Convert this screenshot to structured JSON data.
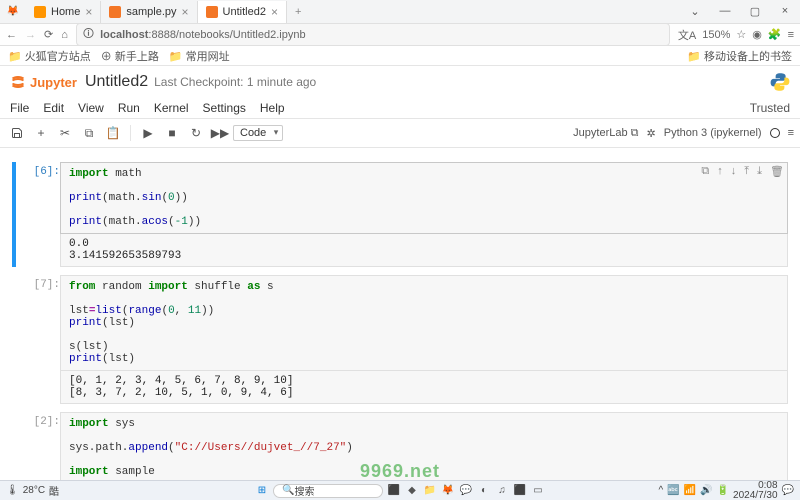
{
  "browser": {
    "tabs": [
      {
        "label": "Home",
        "active": false
      },
      {
        "label": "sample.py",
        "active": false
      },
      {
        "label": "Untitled2",
        "active": true
      }
    ],
    "url_host": "localhost",
    "url_rest": ":8888/notebooks/Untitled2.ipynb",
    "zoom": "150%",
    "bookmarks": [
      {
        "label": "火狐官方站点"
      },
      {
        "label": "新手上路"
      },
      {
        "label": "常用网址"
      }
    ],
    "bookmark_right": "移动设备上的书签"
  },
  "jupyter": {
    "brand": "Jupyter",
    "title": "Untitled2",
    "checkpoint": "Last Checkpoint: 1 minute ago",
    "menus": [
      "File",
      "Edit",
      "View",
      "Run",
      "Kernel",
      "Settings",
      "Help"
    ],
    "trusted": "Trusted",
    "cell_type": "Code",
    "right_label": "JupyterLab",
    "kernel": "Python 3 (ipykernel)"
  },
  "cells": [
    {
      "exec": "[6]:",
      "active": true,
      "output": "0.0\n3.141592653589793",
      "actions": true
    },
    {
      "exec": "[7]:",
      "active": false,
      "output": "[0, 1, 2, 3, 4, 5, 6, 7, 8, 9, 10]\n[8, 3, 7, 2, 10, 5, 1, 0, 9, 4, 6]"
    },
    {
      "exec": "[2]:",
      "active": false,
      "output": null
    }
  ],
  "cell0_lines": {
    "l1a": "import",
    "l1b": " math",
    "l3a": "print",
    "l3b": "(math.",
    "l3c": "sin",
    "l3d": "(",
    "l3e": "0",
    "l3f": "))",
    "l5a": "print",
    "l5b": "(math.",
    "l5c": "acos",
    "l5d": "(",
    "l5e": "-1",
    "l5f": "))"
  },
  "cell1_lines": {
    "l1": {
      "a": "from",
      "b": " random ",
      "c": "import",
      "d": " shuffle ",
      "e": "as",
      "f": " s"
    },
    "l3": {
      "a": "lst",
      "b": "=",
      "c": "list",
      "d": "(",
      "e": "range",
      "f": "(",
      "g": "0",
      "h": ", ",
      "i": "11",
      "j": "))"
    },
    "l4": {
      "a": "print",
      "b": "(lst)"
    },
    "l6": {
      "a": "s(lst)"
    },
    "l7": {
      "a": "print",
      "b": "(lst)"
    }
  },
  "cell2_lines": {
    "l1": {
      "a": "import",
      "b": " sys"
    },
    "l3": {
      "a": "sys.path.",
      "b": "append",
      "c": "(",
      "d": "\"C://Users//dujvet_//7_27\"",
      "e": ")"
    },
    "l5": {
      "a": "import",
      "b": " sample"
    }
  },
  "watermark": "9969.net",
  "taskbar": {
    "temp": "28°C",
    "weather": "酷",
    "search": "搜索",
    "time": "0:08",
    "date": "2024/7/30"
  }
}
